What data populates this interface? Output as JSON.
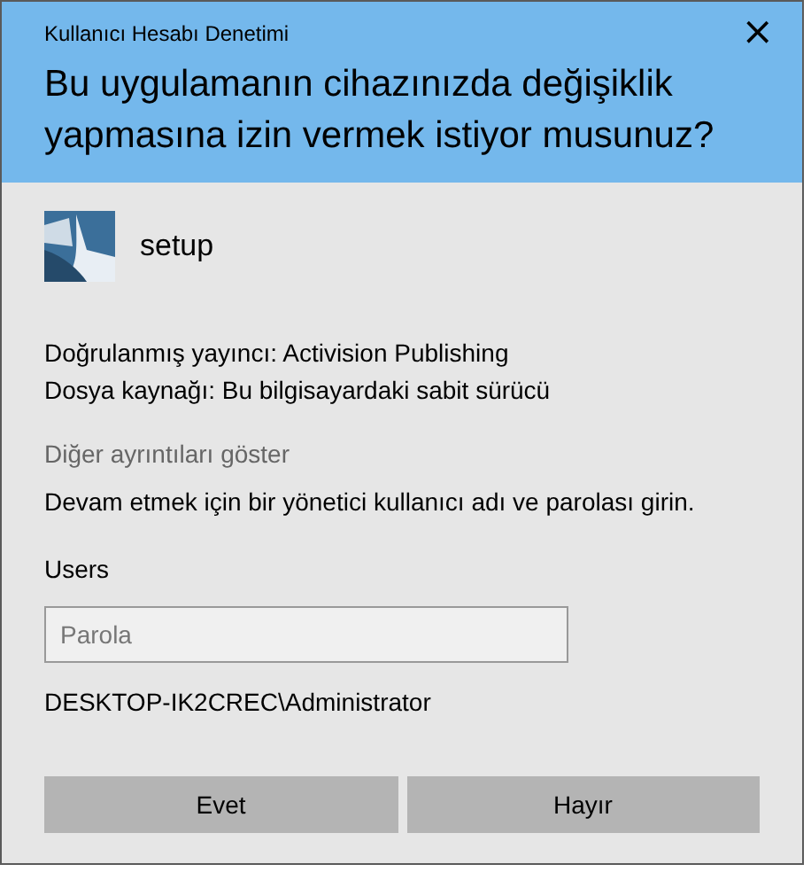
{
  "window": {
    "title": "Kullanıcı Hesabı Denetimi",
    "close": "×"
  },
  "heading": "Bu uygulamanın cihazınızda değişiklik yapmasına izin vermek istiyor musunuz?",
  "app": {
    "name": "setup"
  },
  "details": [
    "Doğrulanmış yayıncı: Activision Publishing",
    "Dosya kaynağı: Bu bilgisayardaki sabit sürücü"
  ],
  "more_details": "Diğer ayrıntıları göster",
  "prompt": "Devam etmek için bir yönetici kullanıcı adı ve parolası girin.",
  "user": "Users",
  "password": {
    "placeholder": "Parola"
  },
  "account": "DESKTOP-IK2CREC\\Administrator",
  "buttons": [
    "Evet",
    "Hayır"
  ]
}
